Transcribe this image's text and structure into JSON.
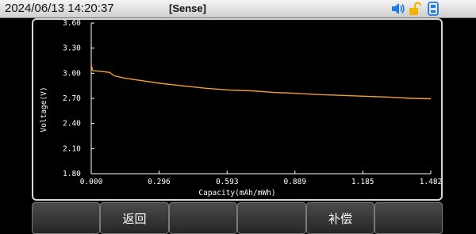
{
  "status_bar": {
    "datetime": "2024/06/13  14:20:37",
    "mode": "[Sense]",
    "icons": [
      "speaker-icon",
      "unlock-icon",
      "usb-icon"
    ],
    "colors": {
      "speaker": "#1e7be0",
      "unlock": "#f2b400",
      "usb": "#1e7be0"
    }
  },
  "chart_data": {
    "type": "line",
    "xlabel": "Capacity(mAh/mWh)",
    "ylabel": "Voltage(V)",
    "xlim": [
      0,
      1.482
    ],
    "ylim": [
      1.8,
      3.6
    ],
    "x_ticks": [
      "0.000",
      "0.296",
      "0.593",
      "0.889",
      "1.185",
      "1.482"
    ],
    "y_ticks": [
      "1.80",
      "2.10",
      "2.40",
      "2.70",
      "3.00",
      "3.30",
      "3.60"
    ],
    "series": [
      {
        "color": "#f0a030",
        "x": [
          0.0,
          0.005,
          0.01,
          0.05,
          0.08,
          0.1,
          0.15,
          0.2,
          0.3,
          0.4,
          0.5,
          0.6,
          0.7,
          0.8,
          0.9,
          1.0,
          1.1,
          1.2,
          1.3,
          1.4,
          1.482
        ],
        "y": [
          3.11,
          3.04,
          3.03,
          3.02,
          3.01,
          2.97,
          2.94,
          2.92,
          2.88,
          2.85,
          2.82,
          2.8,
          2.79,
          2.77,
          2.76,
          2.745,
          2.735,
          2.725,
          2.715,
          2.7,
          2.695
        ]
      }
    ],
    "grid": false
  },
  "softkeys": [
    "",
    "返回",
    "",
    "",
    "补偿",
    ""
  ]
}
